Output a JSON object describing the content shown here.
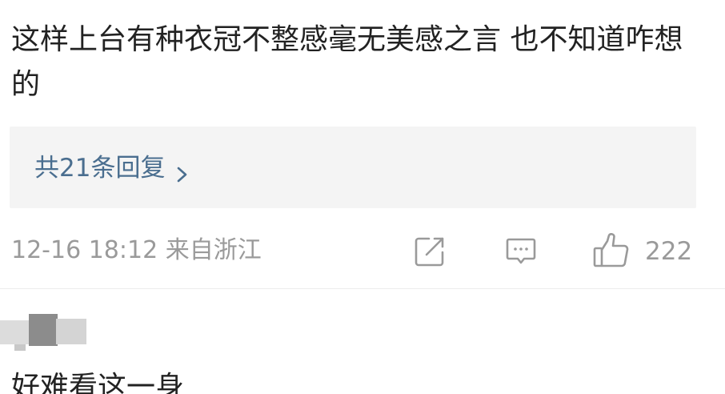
{
  "comment": {
    "text": "这样上台有种衣冠不整感毫无美感之言 也不知道咋想的",
    "replies_label": "共21条回复",
    "meta": "12-16 18:12 来自浙江",
    "like_count": "222",
    "icons": {
      "reply_chevron": "chevron-right-icon",
      "share": "share-icon",
      "comment": "comment-icon",
      "like": "thumbs-up-icon"
    }
  },
  "next_comment": {
    "text": "好难看这一身"
  },
  "colors": {
    "link": "#4a6e8f",
    "meta": "#9a9a9a",
    "reply_bg": "#f4f4f4",
    "text": "#222222"
  }
}
